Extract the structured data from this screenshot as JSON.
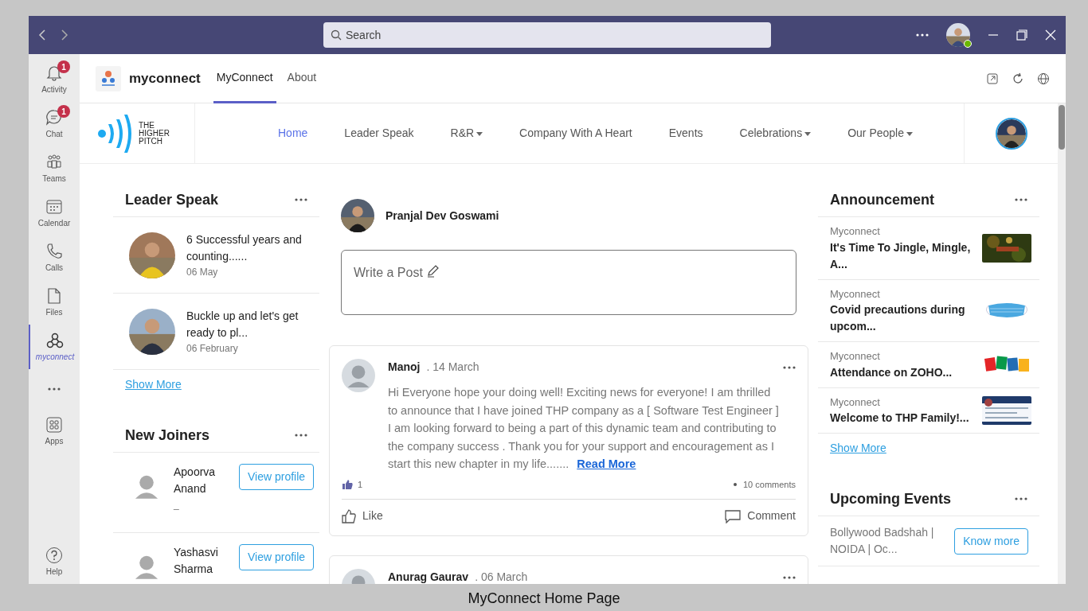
{
  "title_bar": {
    "search_placeholder": "Search"
  },
  "rail": {
    "items": [
      {
        "label": "Activity",
        "badge": "1",
        "selected": false
      },
      {
        "label": "Chat",
        "badge": "1",
        "selected": false
      },
      {
        "label": "Teams",
        "selected": false
      },
      {
        "label": "Calendar",
        "selected": false
      },
      {
        "label": "Calls",
        "selected": false
      },
      {
        "label": "Files",
        "selected": false
      },
      {
        "label": "myconnect",
        "selected": true
      }
    ],
    "bottom": [
      {
        "label": "Apps"
      },
      {
        "label": "Help"
      }
    ]
  },
  "app_header": {
    "name": "myconnect",
    "tabs": [
      {
        "label": "MyConnect",
        "selected": true
      },
      {
        "label": "About",
        "selected": false
      }
    ]
  },
  "site_nav": {
    "logo_lines": [
      "THE",
      "HIGHER",
      "PITCH"
    ],
    "items": [
      {
        "label": "Home",
        "selected": true,
        "dropdown": false
      },
      {
        "label": "Leader Speak",
        "selected": false,
        "dropdown": false
      },
      {
        "label": "R&R",
        "selected": false,
        "dropdown": true
      },
      {
        "label": "Company With A Heart",
        "selected": false,
        "dropdown": false
      },
      {
        "label": "Events",
        "selected": false,
        "dropdown": false
      },
      {
        "label": "Celebrations",
        "selected": false,
        "dropdown": true
      },
      {
        "label": "Our People",
        "selected": false,
        "dropdown": true
      }
    ]
  },
  "leader_speak": {
    "title": "Leader Speak",
    "items": [
      {
        "text": "6 Successful years and counting......",
        "date": "06 May"
      },
      {
        "text": "Buckle up and let's get ready to pl...",
        "date": "06 February"
      }
    ],
    "link": "Show More"
  },
  "new_joiners": {
    "title": "New Joiners",
    "people": [
      {
        "name": "Apoorva Anand",
        "note": "_",
        "action": "View profile"
      },
      {
        "name": "Yashasvi Sharma",
        "action": "View profile"
      }
    ]
  },
  "composer": {
    "user": "Pranjal Dev Goswami",
    "placeholder": "Write a Post"
  },
  "posts": [
    {
      "author": "Manoj",
      "date": ". 14 March",
      "body": "Hi Everyone hope your doing well! Exciting news for everyone! I am thrilled to announce that I have joined THP company as a [ Software Test Engineer ] I am looking forward to being a part of this dynamic team and contributing to the company success . Thank you for your support and encouragement as I start this new chapter in my life.......",
      "read_more": "Read More",
      "likes": "1",
      "comments": "10 comments",
      "like_label": "Like",
      "comment_label": "Comment"
    },
    {
      "author": "Anurag Gaurav",
      "date": ". 06 March"
    }
  ],
  "announcements": {
    "title": "Announcement",
    "items": [
      {
        "source": "Myconnect",
        "title": "It's Time To Jingle, Mingle, A..."
      },
      {
        "source": "Myconnect",
        "title": "Covid precautions during upcom..."
      },
      {
        "source": "Myconnect",
        "title": "Attendance on ZOHO..."
      },
      {
        "source": "Myconnect",
        "title": "Welcome to THP Family!..."
      }
    ],
    "link": "Show More"
  },
  "events": {
    "title": "Upcoming Events",
    "items": [
      {
        "text": "Bollywood Badshah | NOIDA | Oc...",
        "action": "Know more"
      }
    ]
  },
  "caption": "MyConnect Home Page"
}
